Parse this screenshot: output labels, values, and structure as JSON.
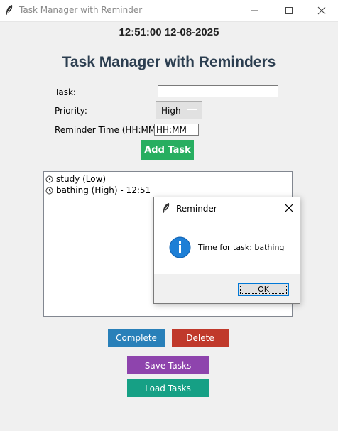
{
  "window": {
    "title": "Task Manager with Reminder",
    "icons": {
      "app": "feather-icon",
      "minimize": "minimize-icon",
      "maximize": "maximize-icon",
      "close": "close-icon"
    }
  },
  "clock": "12:51:00 12-08-2025",
  "heading": "Task Manager with Reminders",
  "form": {
    "task_label": "Task:",
    "task_value": "",
    "priority_label": "Priority:",
    "priority_value": "High",
    "reminder_label": "Reminder Time (HH:MM):",
    "reminder_value": "HH:MM",
    "add_button": "Add Task"
  },
  "tasks": [
    {
      "text": "study (Low)",
      "icon": "clock-icon"
    },
    {
      "text": "bathing (High) - 12:51",
      "icon": "clock-icon"
    }
  ],
  "buttons": {
    "complete": "Complete",
    "delete": "Delete",
    "save": "Save Tasks",
    "load": "Load Tasks"
  },
  "colors": {
    "add": "#27ae60",
    "complete": "#2980b9",
    "delete": "#c0392b",
    "save": "#8e44ad",
    "load": "#16a085",
    "heading": "#2c3e50"
  },
  "dialog": {
    "title": "Reminder",
    "message": "Time for task: bathing",
    "ok": "OK",
    "icon": "info-icon"
  }
}
